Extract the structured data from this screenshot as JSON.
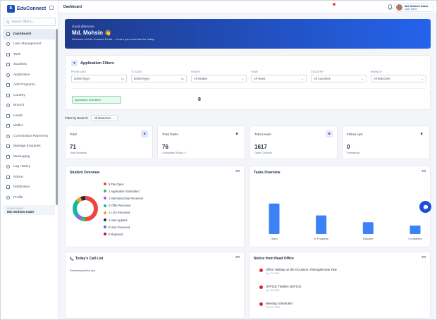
{
  "app": {
    "name": "EduConnect"
  },
  "sidebar": {
    "search_placeholder": "Search Menu...",
    "items": [
      {
        "label": "Dashboard",
        "icon": "home-icon"
      },
      {
        "label": "User Management",
        "icon": "users-icon"
      },
      {
        "label": "Task",
        "icon": "task-icon"
      },
      {
        "label": "Students",
        "icon": "student-icon"
      },
      {
        "label": "Application",
        "icon": "file-icon"
      },
      {
        "label": "Add Programs",
        "icon": "plus-icon"
      },
      {
        "label": "Country",
        "icon": "globe-icon"
      },
      {
        "label": "Branch",
        "icon": "branch-icon"
      },
      {
        "label": "Leads",
        "icon": "leads-icon"
      },
      {
        "label": "Wallet",
        "icon": "wallet-icon"
      },
      {
        "label": "Commission Payments",
        "icon": "commission-icon"
      },
      {
        "label": "Manage Enquiries",
        "icon": "enquiry-icon"
      },
      {
        "label": "Messaging",
        "icon": "message-icon"
      },
      {
        "label": "Log History",
        "icon": "history-icon"
      },
      {
        "label": "Notice",
        "icon": "notice-icon"
      },
      {
        "label": "Notification",
        "icon": "bell-icon"
      },
      {
        "label": "Profile",
        "icon": "profile-icon"
      }
    ],
    "user": {
      "role": "SUPER ADMIN",
      "name": "Md. Mohsin Kabir"
    }
  },
  "topbar": {
    "breadcrumb": "Dashboard",
    "user_name": "Md. Mohsin Kabir",
    "user_role": "super admin"
  },
  "hero": {
    "greeting": "Good afternoon",
    "name": "Md. Mohsin 👋",
    "subtitle": "Welcome to Edu-Connect Portal — here's your overview for today."
  },
  "filters": {
    "title": "Application Filters",
    "fields": [
      {
        "label": "FROM DATE",
        "value": "dd/mm/yyyy",
        "kind": "date"
      },
      {
        "label": "TO DATE",
        "value": "dd/mm/yyyy",
        "kind": "date"
      },
      {
        "label": "INTAKE",
        "value": "All Intakes",
        "kind": "select"
      },
      {
        "label": "YEAR",
        "value": "All Years",
        "kind": "select"
      },
      {
        "label": "COUNTRY",
        "value": "All Countries",
        "kind": "select"
      },
      {
        "label": "BRANCH",
        "value": "All Branches",
        "kind": "select"
      }
    ],
    "status_badge": "Application Submitted",
    "status_count": "8"
  },
  "branch_filter": {
    "label": "Filter by Branch:",
    "value": "All Branches"
  },
  "stats": [
    {
      "title": "Total",
      "value": "71",
      "sub": "Total Students",
      "icon": "eye-icon",
      "color": "#2563eb",
      "bg": "#e0e9fb"
    },
    {
      "title": "Total Tasks",
      "value": "76",
      "sub": "Completed Today: 0",
      "icon": "clipboard-icon",
      "color": "#334155",
      "bg": "#ffffff"
    },
    {
      "title": "Total Leads",
      "value": "1617",
      "sub": "Open Counted",
      "icon": "chart-icon",
      "color": "#4f46e5",
      "bg": "#e6e8fb"
    },
    {
      "title": "Follow Ups",
      "value": "0",
      "sub": "Remaining",
      "icon": "phone-icon",
      "color": "#334155",
      "bg": "#ffffff"
    }
  ],
  "student_overview": {
    "title": "Student Overview",
    "legend": [
      {
        "label": "8 File Open",
        "color": "#ef4444",
        "value": 8
      },
      {
        "label": "1 Application Submitted",
        "color": "#22c55e",
        "value": 1
      },
      {
        "label": "1 Interview Date Received",
        "color": "#a855f7",
        "value": 1
      },
      {
        "label": "4 Offer Received",
        "color": "#14b8a6",
        "value": 4
      },
      {
        "label": "1 LOA Received",
        "color": "#f59e0b",
        "value": 1
      },
      {
        "label": "1 Visa Applied",
        "color": "#1f2937",
        "value": 1
      },
      {
        "label": "0 Visa Received",
        "color": "#6366f1",
        "value": 0
      },
      {
        "label": "0 Rejected",
        "color": "#be123c",
        "value": 0
      }
    ]
  },
  "tasks_overview": {
    "title": "Tasks Overview",
    "chart_data": {
      "type": "bar",
      "categories": [
        "Open",
        "In Progress",
        "Blocked",
        "Completed"
      ],
      "values": [
        36,
        22,
        14,
        10
      ],
      "ylim": [
        0,
        60
      ],
      "color": "#3b82f6"
    }
  },
  "call_list": {
    "title": "Today's Call List",
    "icon": "phone-icon",
    "sub": "Remaining follow-ups"
  },
  "notices": {
    "title": "Notice from Head Office",
    "items": [
      {
        "title": "Office Holiday on the Occasion of Bengali New Year",
        "date": "Apr 13, 2024"
      },
      {
        "title": "OFFICE TIMING NOTICE",
        "date": "Apr 18, 2024"
      },
      {
        "title": "Meeting Scheduled",
        "date": "Feb 27, 2024"
      }
    ]
  }
}
